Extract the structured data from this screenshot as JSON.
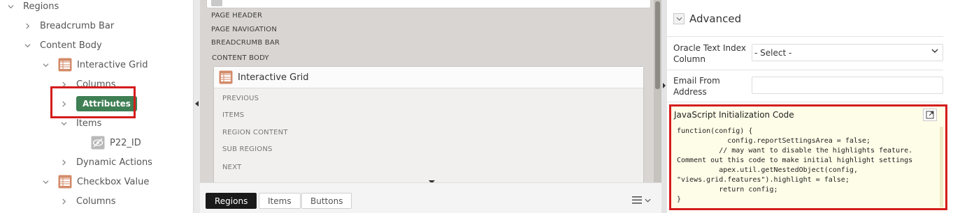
{
  "tree": {
    "regions": "Regions",
    "breadcrumb_bar": "Breadcrumb Bar",
    "content_body": "Content Body",
    "interactive_grid": "Interactive Grid",
    "columns": "Columns",
    "attributes": "Attributes",
    "items": "Items",
    "p22_id": "P22_ID",
    "dynamic_actions": "Dynamic Actions",
    "checkbox_value": "Checkbox Value",
    "columns2": "Columns"
  },
  "layout_view": {
    "page_header": "PAGE HEADER",
    "page_navigation": "PAGE NAVIGATION",
    "breadcrumb_bar": "BREADCRUMB BAR",
    "content_body": "CONTENT BODY",
    "ig_title": "Interactive Grid",
    "slots": [
      "PREVIOUS",
      "ITEMS",
      "REGION CONTENT",
      "SUB REGIONS",
      "NEXT"
    ]
  },
  "bottom_tabs": {
    "regions": "Regions",
    "items": "Items",
    "buttons": "Buttons"
  },
  "properties": {
    "section_title": "Advanced",
    "oracle_text_label": "Oracle Text Index Column",
    "oracle_text_value": "- Select -",
    "email_from_label": "Email From Address",
    "email_from_value": "",
    "js_label": "JavaScript Initialization Code",
    "code_lines": [
      "function(config) {",
      "            config.reportSettingsArea = false;",
      "          // may want to disable the highlights feature.",
      "Comment out this code to make initial highlight settings",
      "          apex.util.getNestedObject(config,",
      "\"views.grid.features\").highlight = false;",
      "          return config;",
      "}"
    ]
  },
  "colors": {
    "highlight_red": "#d41c1c",
    "attributes_green": "#3f7f54",
    "code_bg": "#fefde8",
    "region_icon": "#d38b6a"
  }
}
